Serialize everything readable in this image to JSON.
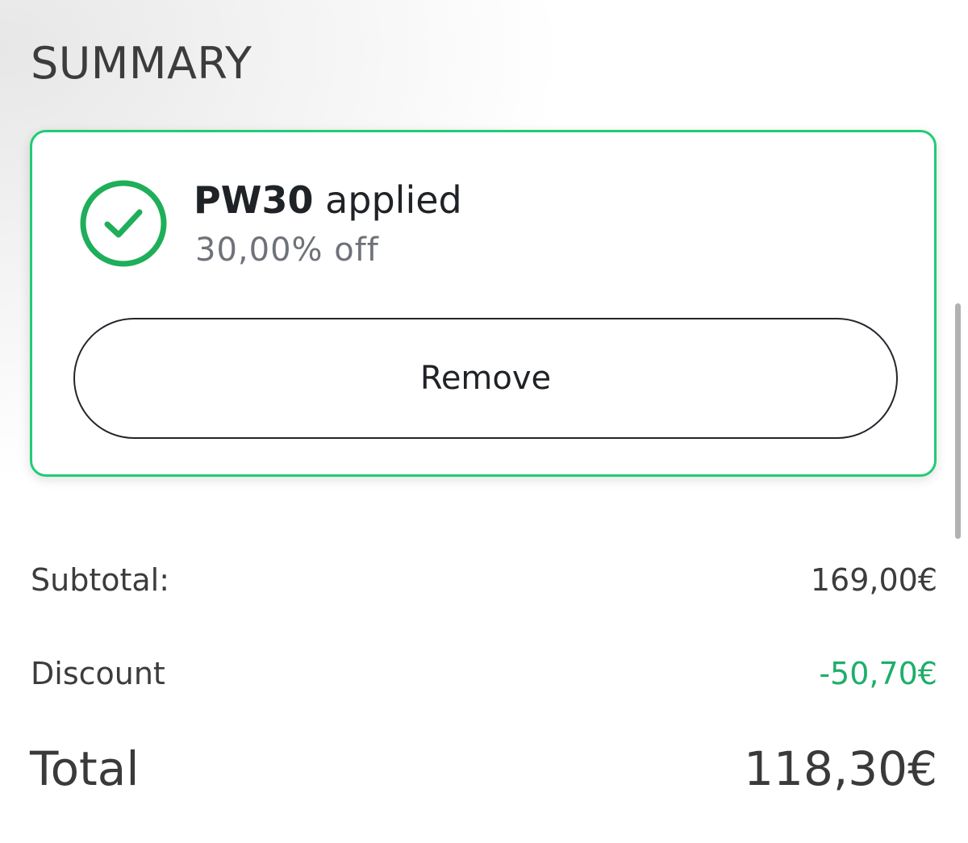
{
  "summary": {
    "title": "SUMMARY"
  },
  "promo": {
    "code": "PW30",
    "applied_text": "applied",
    "discount_text": "30,00% off",
    "remove_label": "Remove",
    "status_icon": "check-circle-icon",
    "accent_color": "#20cc75"
  },
  "totals": {
    "subtotal_label": "Subtotal:",
    "subtotal_value": "169,00€",
    "discount_label": "Discount",
    "discount_value": "-50,70€",
    "discount_color": "#1fae6a",
    "total_label": "Total",
    "total_value": "118,30€"
  }
}
